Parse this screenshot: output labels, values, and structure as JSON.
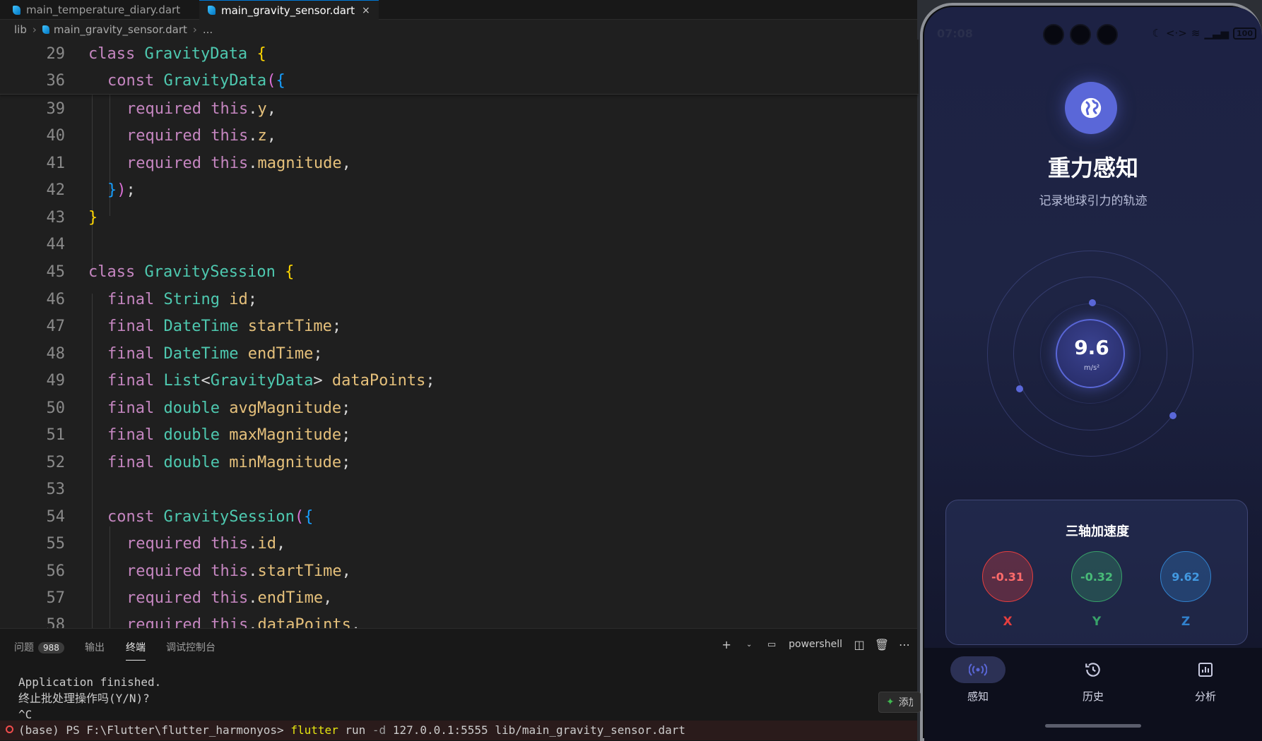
{
  "editor": {
    "tabs": [
      {
        "label": "main_temperature_diary.dart"
      },
      {
        "label": "main_gravity_sensor.dart",
        "close": "×"
      }
    ],
    "breadcrumb": {
      "root": "lib",
      "file": "main_gravity_sensor.dart",
      "more": "..."
    },
    "sticky": [
      {
        "num": "29",
        "text": "class GravityData {"
      },
      {
        "num": "36",
        "text": "const GravityData({"
      }
    ],
    "lines": [
      {
        "num": "39"
      },
      {
        "num": "40"
      },
      {
        "num": "41"
      },
      {
        "num": "42"
      },
      {
        "num": "43"
      },
      {
        "num": "44"
      },
      {
        "num": "45"
      },
      {
        "num": "46"
      },
      {
        "num": "47"
      },
      {
        "num": "48"
      },
      {
        "num": "49"
      },
      {
        "num": "50"
      },
      {
        "num": "51"
      },
      {
        "num": "52"
      },
      {
        "num": "53"
      },
      {
        "num": "54"
      },
      {
        "num": "55"
      },
      {
        "num": "56"
      },
      {
        "num": "57"
      },
      {
        "num": "58"
      }
    ]
  },
  "panel": {
    "tabs": {
      "problems": "问题",
      "problems_count": "988",
      "output": "输出",
      "terminal": "终端",
      "debug": "调试控制台"
    },
    "shell": "powershell",
    "terminal_lines": [
      "Application finished.",
      "终止批处理操作吗(Y/N)?",
      "^C"
    ],
    "prompt": {
      "prefix": "(base) PS F:\\Flutter\\flutter_harmonyos> ",
      "cmd": "flutter",
      "rest1": " run ",
      "flag": "-d",
      "rest2": " 127.0.0.1:5555 lib/main_gravity_sensor.dart"
    },
    "add_label": "添加"
  },
  "phone": {
    "status": {
      "time": "07:08",
      "battery": "100"
    },
    "title": "重力感知",
    "subtitle": "记录地球引力的轨迹",
    "gauge": {
      "value": "9.6",
      "unit": "m/s²"
    },
    "card": {
      "title": "三轴加速度",
      "axes": [
        {
          "value": "-0.31",
          "label": "X",
          "color": "#e53e3e"
        },
        {
          "value": "-0.32",
          "label": "Y",
          "color": "#38a169"
        },
        {
          "value": "9.62",
          "label": "Z",
          "color": "#3182ce"
        }
      ]
    },
    "nav": [
      {
        "label": "感知",
        "icon": "sensor-icon",
        "active": true
      },
      {
        "label": "历史",
        "icon": "history-icon",
        "active": false
      },
      {
        "label": "分析",
        "icon": "analytics-icon",
        "active": false
      }
    ]
  }
}
